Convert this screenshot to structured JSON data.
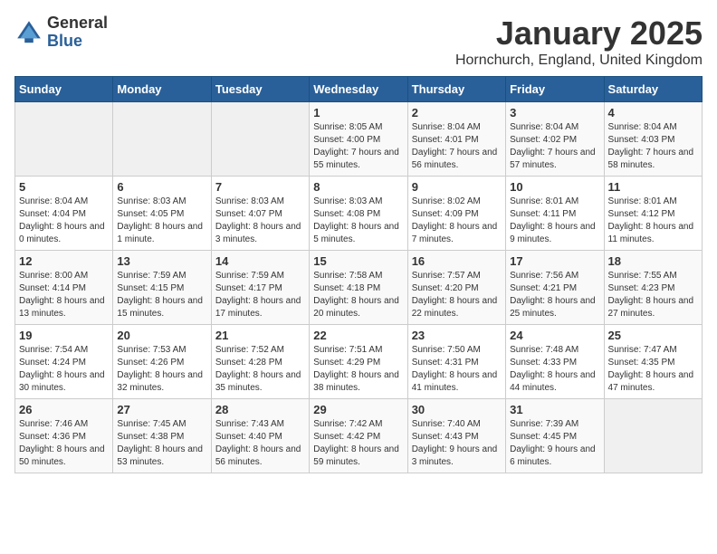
{
  "header": {
    "logo_general": "General",
    "logo_blue": "Blue",
    "title": "January 2025",
    "location": "Hornchurch, England, United Kingdom"
  },
  "days_of_week": [
    "Sunday",
    "Monday",
    "Tuesday",
    "Wednesday",
    "Thursday",
    "Friday",
    "Saturday"
  ],
  "weeks": [
    [
      {
        "day": "",
        "content": ""
      },
      {
        "day": "",
        "content": ""
      },
      {
        "day": "",
        "content": ""
      },
      {
        "day": "1",
        "content": "Sunrise: 8:05 AM\nSunset: 4:00 PM\nDaylight: 7 hours\nand 55 minutes."
      },
      {
        "day": "2",
        "content": "Sunrise: 8:04 AM\nSunset: 4:01 PM\nDaylight: 7 hours\nand 56 minutes."
      },
      {
        "day": "3",
        "content": "Sunrise: 8:04 AM\nSunset: 4:02 PM\nDaylight: 7 hours\nand 57 minutes."
      },
      {
        "day": "4",
        "content": "Sunrise: 8:04 AM\nSunset: 4:03 PM\nDaylight: 7 hours\nand 58 minutes."
      }
    ],
    [
      {
        "day": "5",
        "content": "Sunrise: 8:04 AM\nSunset: 4:04 PM\nDaylight: 8 hours\nand 0 minutes."
      },
      {
        "day": "6",
        "content": "Sunrise: 8:03 AM\nSunset: 4:05 PM\nDaylight: 8 hours\nand 1 minute."
      },
      {
        "day": "7",
        "content": "Sunrise: 8:03 AM\nSunset: 4:07 PM\nDaylight: 8 hours\nand 3 minutes."
      },
      {
        "day": "8",
        "content": "Sunrise: 8:03 AM\nSunset: 4:08 PM\nDaylight: 8 hours\nand 5 minutes."
      },
      {
        "day": "9",
        "content": "Sunrise: 8:02 AM\nSunset: 4:09 PM\nDaylight: 8 hours\nand 7 minutes."
      },
      {
        "day": "10",
        "content": "Sunrise: 8:01 AM\nSunset: 4:11 PM\nDaylight: 8 hours\nand 9 minutes."
      },
      {
        "day": "11",
        "content": "Sunrise: 8:01 AM\nSunset: 4:12 PM\nDaylight: 8 hours\nand 11 minutes."
      }
    ],
    [
      {
        "day": "12",
        "content": "Sunrise: 8:00 AM\nSunset: 4:14 PM\nDaylight: 8 hours\nand 13 minutes."
      },
      {
        "day": "13",
        "content": "Sunrise: 7:59 AM\nSunset: 4:15 PM\nDaylight: 8 hours\nand 15 minutes."
      },
      {
        "day": "14",
        "content": "Sunrise: 7:59 AM\nSunset: 4:17 PM\nDaylight: 8 hours\nand 17 minutes."
      },
      {
        "day": "15",
        "content": "Sunrise: 7:58 AM\nSunset: 4:18 PM\nDaylight: 8 hours\nand 20 minutes."
      },
      {
        "day": "16",
        "content": "Sunrise: 7:57 AM\nSunset: 4:20 PM\nDaylight: 8 hours\nand 22 minutes."
      },
      {
        "day": "17",
        "content": "Sunrise: 7:56 AM\nSunset: 4:21 PM\nDaylight: 8 hours\nand 25 minutes."
      },
      {
        "day": "18",
        "content": "Sunrise: 7:55 AM\nSunset: 4:23 PM\nDaylight: 8 hours\nand 27 minutes."
      }
    ],
    [
      {
        "day": "19",
        "content": "Sunrise: 7:54 AM\nSunset: 4:24 PM\nDaylight: 8 hours\nand 30 minutes."
      },
      {
        "day": "20",
        "content": "Sunrise: 7:53 AM\nSunset: 4:26 PM\nDaylight: 8 hours\nand 32 minutes."
      },
      {
        "day": "21",
        "content": "Sunrise: 7:52 AM\nSunset: 4:28 PM\nDaylight: 8 hours\nand 35 minutes."
      },
      {
        "day": "22",
        "content": "Sunrise: 7:51 AM\nSunset: 4:29 PM\nDaylight: 8 hours\nand 38 minutes."
      },
      {
        "day": "23",
        "content": "Sunrise: 7:50 AM\nSunset: 4:31 PM\nDaylight: 8 hours\nand 41 minutes."
      },
      {
        "day": "24",
        "content": "Sunrise: 7:48 AM\nSunset: 4:33 PM\nDaylight: 8 hours\nand 44 minutes."
      },
      {
        "day": "25",
        "content": "Sunrise: 7:47 AM\nSunset: 4:35 PM\nDaylight: 8 hours\nand 47 minutes."
      }
    ],
    [
      {
        "day": "26",
        "content": "Sunrise: 7:46 AM\nSunset: 4:36 PM\nDaylight: 8 hours\nand 50 minutes."
      },
      {
        "day": "27",
        "content": "Sunrise: 7:45 AM\nSunset: 4:38 PM\nDaylight: 8 hours\nand 53 minutes."
      },
      {
        "day": "28",
        "content": "Sunrise: 7:43 AM\nSunset: 4:40 PM\nDaylight: 8 hours\nand 56 minutes."
      },
      {
        "day": "29",
        "content": "Sunrise: 7:42 AM\nSunset: 4:42 PM\nDaylight: 8 hours\nand 59 minutes."
      },
      {
        "day": "30",
        "content": "Sunrise: 7:40 AM\nSunset: 4:43 PM\nDaylight: 9 hours\nand 3 minutes."
      },
      {
        "day": "31",
        "content": "Sunrise: 7:39 AM\nSunset: 4:45 PM\nDaylight: 9 hours\nand 6 minutes."
      },
      {
        "day": "",
        "content": ""
      }
    ]
  ]
}
